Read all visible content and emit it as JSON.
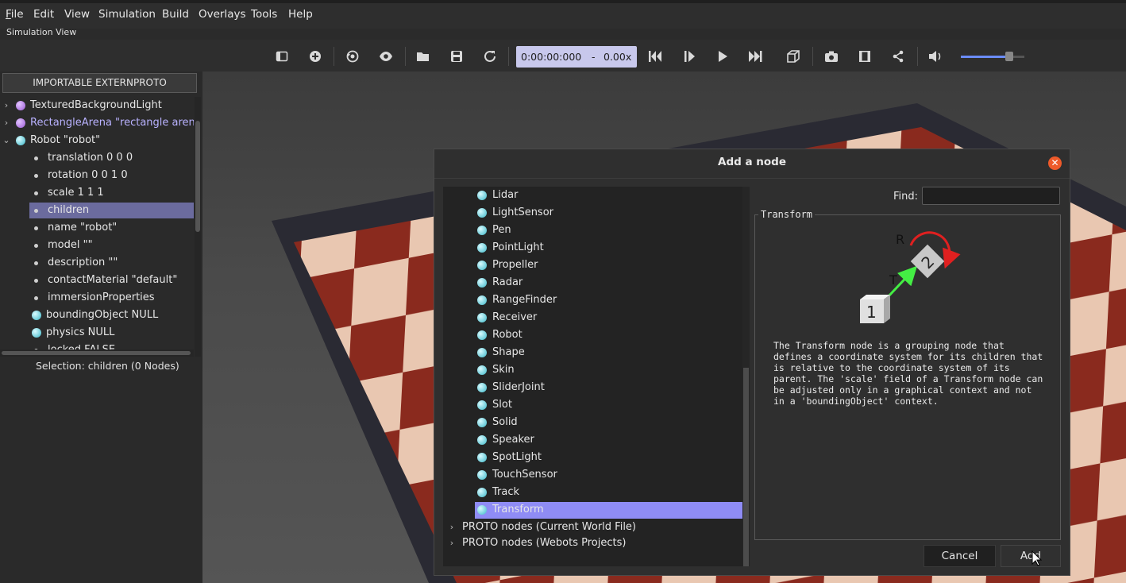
{
  "menu": [
    "File",
    "Edit",
    "View",
    "Simulation",
    "Build",
    "Overlays",
    "Tools",
    "Help"
  ],
  "menu_mnemonic_letters": [
    "F",
    "E",
    "V",
    "S",
    "B",
    "O",
    "T",
    "H"
  ],
  "panel_label": "Simulation View",
  "toolbar": {
    "icons": [
      "toggle-panel-icon",
      "add-node-icon",
      "reset-view-icon",
      "eye-icon",
      "open-folder-icon",
      "save-icon",
      "reload-icon",
      "step-back-icon",
      "step-icon",
      "play-icon",
      "fast-forward-icon",
      "cube-view-icon",
      "camera-icon",
      "film-icon",
      "share-icon",
      "volume-icon"
    ],
    "time": "0:00:00:000",
    "time_sep": "-",
    "speed": "0.00x",
    "volume_level": 0.75,
    "time_box_color": "#c8c8ec"
  },
  "scene_tree": {
    "import_button": "IMPORTABLE EXTERNPROTO",
    "items": [
      {
        "label": "TexturedBackgroundLight",
        "kind": "purple",
        "expander": "›"
      },
      {
        "label": "RectangleArena \"rectangle arena\"",
        "kind": "purple",
        "expander": "›",
        "color": "#b9b2ff"
      },
      {
        "label": "Robot \"robot\"",
        "kind": "cyan",
        "expander": "⌄"
      },
      {
        "label": "translation 0 0 0",
        "kind": "field"
      },
      {
        "label": "rotation 0 0 1 0",
        "kind": "field"
      },
      {
        "label": "scale 1 1 1",
        "kind": "field"
      },
      {
        "label": "children",
        "kind": "field",
        "selected": true
      },
      {
        "label": "name \"robot\"",
        "kind": "field"
      },
      {
        "label": "model \"\"",
        "kind": "field"
      },
      {
        "label": "description \"\"",
        "kind": "field"
      },
      {
        "label": "contactMaterial \"default\"",
        "kind": "field"
      },
      {
        "label": "immersionProperties",
        "kind": "field"
      },
      {
        "label": "boundingObject NULL",
        "kind": "cyanfield"
      },
      {
        "label": "physics NULL",
        "kind": "cyanfield"
      },
      {
        "label": "locked FALSE",
        "kind": "field"
      }
    ],
    "selection": "Selection: children (0 Nodes)"
  },
  "dialog": {
    "title": "Add a node",
    "close_icon": "close-icon",
    "find_label": "Find:",
    "find_value": "",
    "nodes": [
      "Lidar",
      "LightSensor",
      "Pen",
      "PointLight",
      "Propeller",
      "Radar",
      "RangeFinder",
      "Receiver",
      "Robot",
      "Shape",
      "Skin",
      "SliderJoint",
      "Slot",
      "Solid",
      "Speaker",
      "SpotLight",
      "TouchSensor",
      "Track",
      "Transform"
    ],
    "selected_node": "Transform",
    "categories": [
      "PROTO nodes (Current World File)",
      "PROTO nodes (Webots Projects)"
    ],
    "info_title": "Transform",
    "diagram_labels": {
      "r": "R",
      "t": "T",
      "box1": "1",
      "box2": "2"
    },
    "description": "The Transform node is a grouping node that defines a coordinate system for its children that is relative to the coordinate system of its parent. The 'scale' field of a Transform node can be adjusted only in a graphical context and not in a 'boundingObject' context.",
    "cancel_label": "Cancel",
    "add_label": "Add"
  },
  "colors": {
    "accent": "#8f8cf5",
    "selection": "#6b6b9e",
    "close": "#ee5a2a"
  }
}
